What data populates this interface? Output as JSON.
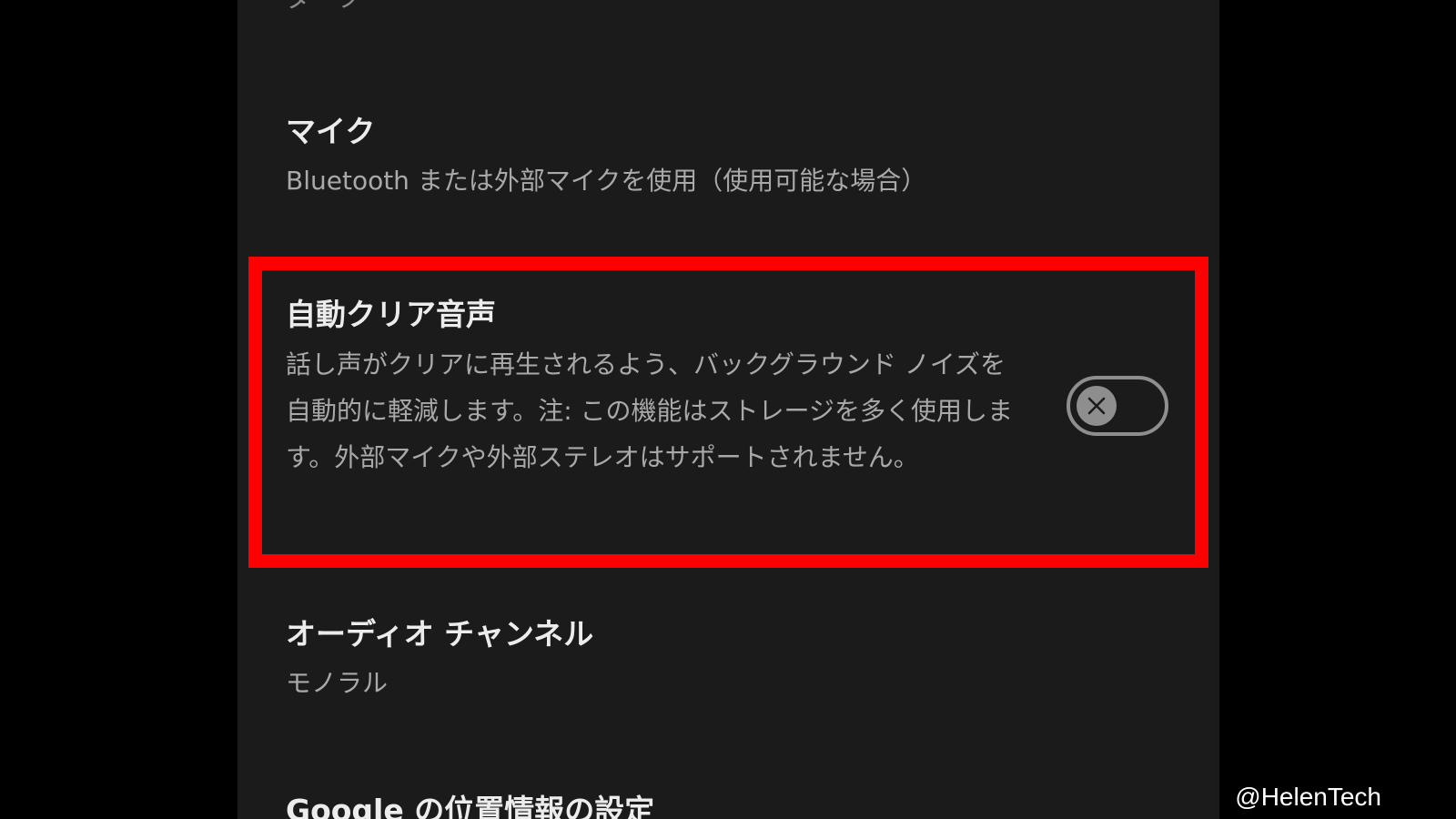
{
  "previous_setting": {
    "value_partial": "ダーク"
  },
  "settings": {
    "microphone": {
      "title": "マイク",
      "subtitle": "Bluetooth または外部マイクを使用（使用可能な場合）"
    },
    "auto_clear_voice": {
      "title": "自動クリア音声",
      "description": "話し声がクリアに再生されるよう、バックグラウンド ノイズを自動的に軽減します。注: この機能はストレージを多く使用します。外部マイクや外部ステレオはサポートされません。",
      "toggle_state": "off",
      "toggle_icon": "close-icon"
    },
    "audio_channel": {
      "title": "オーディオ チャンネル",
      "subtitle": "モノラル"
    },
    "google_location": {
      "title": "Google の位置情報の設定"
    }
  },
  "watermark": {
    "text": "@HelenTech"
  },
  "colors": {
    "background": "#000000",
    "panel": "#1b1b1b",
    "highlight_border": "#ff0000",
    "toggle_off": "#8e8e8e"
  }
}
